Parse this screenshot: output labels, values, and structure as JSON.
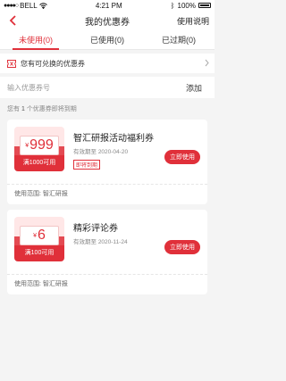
{
  "status_bar": {
    "carrier": "BELL",
    "time": "4:21 PM",
    "battery": "100%"
  },
  "nav": {
    "title": "我的优惠券",
    "action_label": "使用说明"
  },
  "tabs": [
    {
      "label": "未使用(0)",
      "active": true
    },
    {
      "label": "已使用(0)",
      "active": false
    },
    {
      "label": "已过期(0)",
      "active": false
    }
  ],
  "redeem": {
    "label": "您有可兑换的优惠券"
  },
  "code_input": {
    "placeholder": "输入优惠券号",
    "value": "",
    "add_label": "添加"
  },
  "notice": {
    "prefix": "您有",
    "count": "1",
    "suffix": "个优惠券即将到期"
  },
  "coupons": [
    {
      "currency": "¥",
      "amount": "999",
      "threshold": "满1000可用",
      "title": "智汇研报活动福利券",
      "expiry_label": "有效期至",
      "expiry_date": "2020-04-20",
      "tag": "即将到期",
      "button": "立即使用",
      "scope_label": "使用范围:",
      "scope_value": "智汇研报"
    },
    {
      "currency": "¥",
      "amount": "6",
      "threshold": "满100可用",
      "title": "精彩评论券",
      "expiry_label": "有效期至",
      "expiry_date": "2020-11-24",
      "button": "立即使用",
      "scope_label": "使用范围:",
      "scope_value": "智汇研报"
    }
  ],
  "colors": {
    "accent": "#e0303a",
    "background": "#f4f4f4"
  }
}
